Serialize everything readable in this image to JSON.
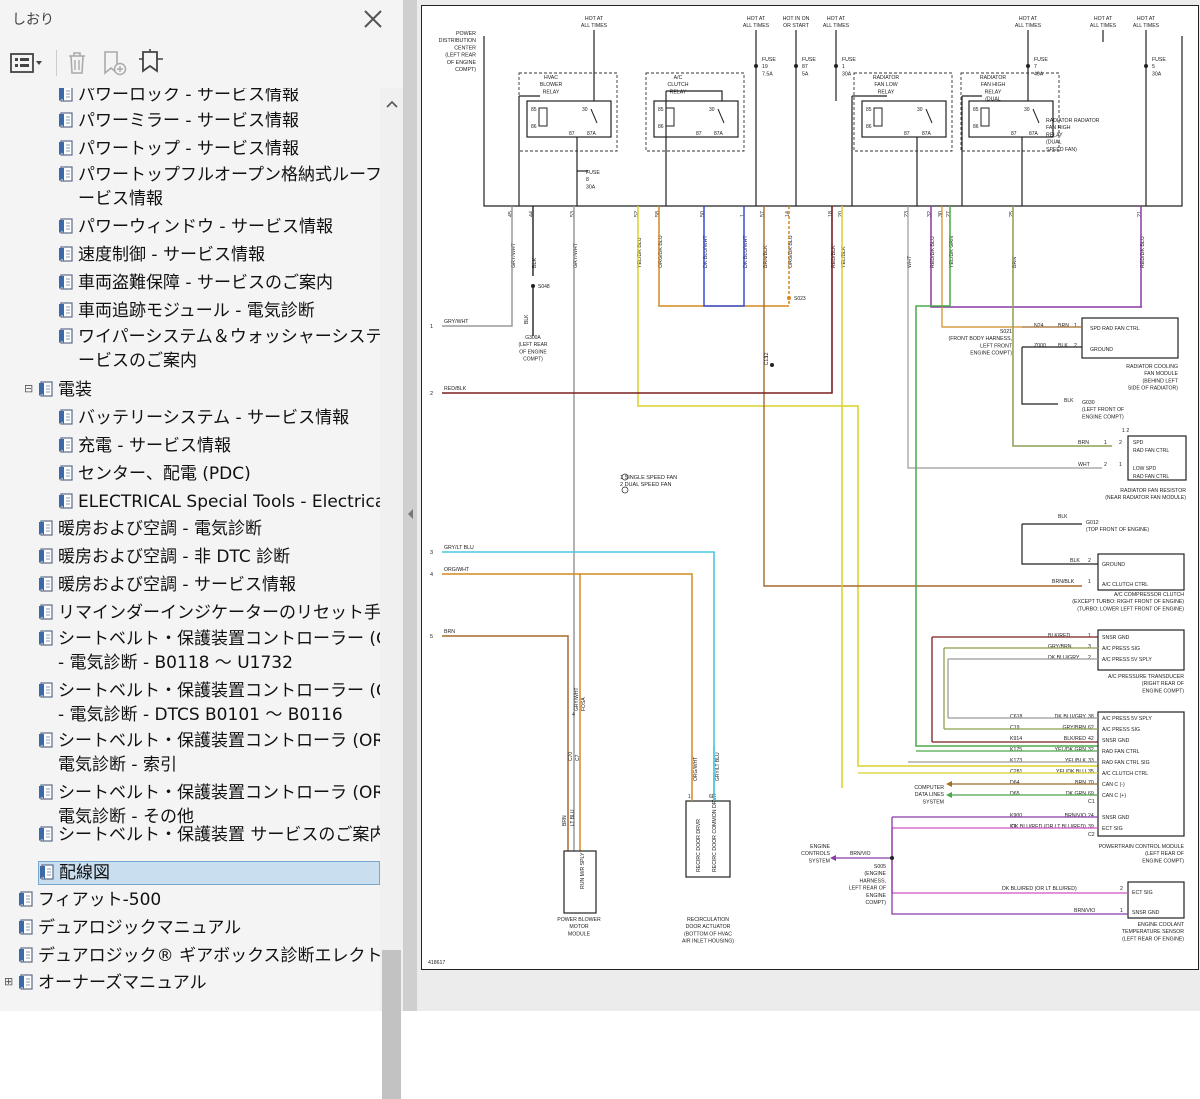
{
  "bookmarks_panel": {
    "title": "しおり",
    "toolbar": {
      "options": "options-menu-icon",
      "delete": "trash-icon",
      "add_bookmark": "bookmark-add-icon",
      "find_current": "bookmark-find-icon"
    },
    "items": [
      {
        "label": "パワーロック - サービス情報",
        "level": 2
      },
      {
        "label": "パワーミラー - サービス情報",
        "level": 2
      },
      {
        "label": "パワートップ - サービス情報",
        "level": 2
      },
      {
        "label": "パワートップフルオープン格納式ルーフ - サ",
        "label2": "ービス情報",
        "level": 2
      },
      {
        "label": "パワーウィンドウ - サービス情報",
        "level": 2
      },
      {
        "label": "速度制御 - サービス情報",
        "level": 2
      },
      {
        "label": "車両盗難保障 - サービスのご案内",
        "level": 2
      },
      {
        "label": "車両追跡モジュール - 電気診断",
        "level": 2
      },
      {
        "label": "ワイパーシステム＆ウォッシャーシステム - サ",
        "label2": "ービスのご案内",
        "level": 2
      },
      {
        "label": "電装",
        "level": 1,
        "expanded": true
      },
      {
        "label": "バッテリーシステム - サービス情報",
        "level": 2
      },
      {
        "label": "充電 - サービス情報",
        "level": 2
      },
      {
        "label": "センター、配電 (PDC)",
        "level": 2
      },
      {
        "label": "ELECTRICAL Special Tools - Electrical",
        "level": 2
      },
      {
        "label": "暖房および空調 - 電気診断",
        "level": 1
      },
      {
        "label": "暖房および空調 - 非 DTC 診断",
        "level": 1
      },
      {
        "label": "暖房および空調 - サービス情報",
        "level": 1
      },
      {
        "label": "リマインダーインジケーターのリセット手順",
        "level": 1
      },
      {
        "label": "シートベルト・保護装置コントローラー (ORC)",
        "label2": "- 電気診断 - B0118 ～ U1732",
        "level": 1
      },
      {
        "label": "シートベルト・保護装置コントローラー (ORC)",
        "label2": "- 電気診断 - DTCS B0101 ～ B0116",
        "level": 1
      },
      {
        "label": "シートベルト・保護装置コントローラ (ORC) -",
        "label2": "電気診断 - 索引",
        "level": 1
      },
      {
        "label": "シートベルト・保護装置コントローラ (ORC) -",
        "label2": "電気診断 - その他",
        "level": 1
      },
      {
        "label": "シートベルト・保護装置 サービスのご案内",
        "level": 1
      },
      {
        "label": "配線図",
        "level": 1,
        "selected": true
      },
      {
        "label": "フィアット-500",
        "level": 0
      },
      {
        "label": "デュアロジックマニュアル",
        "level": 0
      },
      {
        "label": "デュアロジック® ギアボックス診断エレクトロニクス",
        "level": 0
      },
      {
        "label": "オーナーズマニュアル",
        "level": 0,
        "collapsed": true
      }
    ]
  },
  "diagram": {
    "top_labels": {
      "hot_all_1": [
        "HOT AT",
        "ALL TIMES"
      ],
      "hot_all_2": [
        "HOT AT",
        "ALL TIMES"
      ],
      "hot_run": [
        "HOT IN ON",
        "OR START"
      ],
      "hot_all_3": [
        "HOT AT",
        "ALL TIMES"
      ],
      "hot_all_4": [
        "HOT AT",
        "ALL TIMES"
      ],
      "hot_all_5": [
        "HOT AT",
        "ALL TIMES"
      ],
      "hot_all_6": [
        "HOT AT",
        "ALL TIMES"
      ]
    },
    "pdc": [
      "POWER",
      "DISTRIBUTION",
      "CENTER",
      "(LEFT REAR",
      "OF ENGINE",
      "COMPT)"
    ],
    "fuses": [
      [
        "FUSE",
        "19",
        "7.5A"
      ],
      [
        "FUSE",
        "87",
        "5A"
      ],
      [
        "FUSE",
        "1",
        "30A"
      ],
      [
        "FUSE",
        "7",
        "40A"
      ],
      [
        "FUSE",
        "5",
        "30A"
      ],
      [
        "FUSE",
        "8",
        "30A"
      ]
    ],
    "relays": {
      "blower": [
        "HVAC",
        "BLOWER",
        "RELAY"
      ],
      "clutch": [
        "A/C",
        "CLUTCH",
        "RELAY"
      ],
      "fan_low": [
        "RADIATOR",
        "FAN LOW",
        "RELAY"
      ],
      "fan_high": [
        "RADIATOR",
        "FAN HIGH",
        "RELAY",
        "(DUAL",
        "SPEED FAN)"
      ]
    },
    "pins_top": [
      "45",
      "44",
      "53",
      "52",
      "58",
      "50",
      "1",
      "57",
      "14",
      "18",
      "20",
      "23",
      "32",
      "30",
      "27",
      "25",
      "21"
    ],
    "vwires": [
      "GRY/WHT",
      "BLK",
      "GRY/WHT",
      "YEL/DK BLU",
      "ORG/DK BLU",
      "DK BLU/WHT",
      "DK BLU/WHT",
      "BRN/BLK",
      "ORG/DK BLU",
      "RED/BLK",
      "YEL/BLK",
      "WHT",
      "RED/DK BLU",
      "YEL/DK GRN",
      "BRN",
      "RED/DK BLU"
    ],
    "left_numbers": [
      "1",
      "2",
      "3",
      "4",
      "5"
    ],
    "left_wires": [
      "GRY/WHT",
      "RED/BLK",
      "GRY/LT BLU",
      "ORG/WHT",
      "BRN"
    ],
    "splices": {
      "s048": "S048",
      "g300": [
        "G300A",
        "(LEFT REAR",
        "OF ENGINE",
        "COMPT)"
      ],
      "s023": "S023",
      "c13": [
        "12",
        "C13"
      ]
    },
    "legend": [
      "1 SINGLE SPEED FAN",
      "2 DUAL SPEED FAN"
    ],
    "rad_fan_module": {
      "pins": [
        [
          "N24",
          "BRN",
          "1",
          "SPD RAD FAN CTRL"
        ],
        [
          "Z000",
          "BLK",
          "2",
          "GROUND"
        ]
      ],
      "splice": [
        "S021",
        "(FRONT BODY HARNESS,",
        "LEFT FRONT",
        "ENGINE COMPT)"
      ],
      "name": [
        "RADIATOR COOLING",
        "FAN MODULE",
        "(BEHIND LEFT",
        "SIDE OF RADIATOR)"
      ],
      "ground": [
        "G030",
        "(LEFT FRONT OF",
        "ENGINE COMPT)",
        "BLK"
      ]
    },
    "rad_fan_resistor": {
      "pins": [
        [
          "BRN",
          "1",
          "2",
          "SPD",
          "RAD FAN CTRL"
        ],
        [
          "WHT",
          "2",
          "1",
          "LOW SPD",
          "RAD FAN CTRL"
        ]
      ],
      "name": [
        "RADIATOR FAN RESISTOR",
        "(NEAR RADIATOR FAN MODULE)"
      ]
    },
    "compressor": {
      "ground": [
        "BLK",
        "G012",
        "(TOP FRONT OF ENGINE)"
      ],
      "pins": [
        [
          "BLK",
          "2",
          "GROUND"
        ],
        [
          "BRN/BLK",
          "1",
          "A/C CLUTCH CTRL"
        ]
      ],
      "name": [
        "A/C COMPRESSOR CLUTCH",
        "(EXCEPT TURBO: RIGHT FRONT OF ENGINE)",
        "(TURBO: LOWER LEFT FRONT OF ENGINE)"
      ]
    },
    "transducer": {
      "pins": [
        [
          "BLK/RED",
          "1",
          "SNSR GND"
        ],
        [
          "GRY/BRN",
          "3",
          "A/C PRESS SIG"
        ],
        [
          "DK BLU/GRY",
          "2",
          "A/C PRESS 5V SPLY"
        ]
      ],
      "name": [
        "A/C PRESSURE TRANSDUCER",
        "(RIGHT REAR OF",
        "ENGINE COMPT)"
      ]
    },
    "pcm": {
      "rows": [
        [
          "C618",
          "DK BLU/GRY",
          "38",
          "A/C PRESS 5V SPLY"
        ],
        [
          "C19",
          "GRY/BRN",
          "62",
          "A/C PRESS SIG"
        ],
        [
          "K914",
          "BLK/RED",
          "42",
          "SNSR GND"
        ],
        [
          "K175",
          "YEL/DK GRN",
          "32",
          "RAD FAN CTRL"
        ],
        [
          "K173",
          "YEL/BLK",
          "33",
          "RAD FAN CTRL SIG"
        ],
        [
          "C281",
          "YEL/DK BLU",
          "35",
          "A/C CLUTCH CTRL"
        ],
        [
          "D64",
          "BRN",
          "70",
          "CAN C (-)"
        ],
        [
          "D65",
          "DK GRN",
          "69",
          "CAN C (+)"
        ],
        [
          "",
          "",
          "C1",
          ""
        ],
        [
          "K900",
          "BRN/VIO",
          "24",
          "SNSR GND"
        ],
        [
          "K2",
          "DK BLU/RED (OR LT BLU/RED)",
          "39",
          "ECT SIG"
        ],
        [
          "",
          "",
          "C2",
          ""
        ]
      ],
      "name": [
        "POWERTRAIN CONTROL MODULE",
        "(LEFT REAR OF",
        "ENGINE COMPT)"
      ],
      "comp_data": [
        "COMPUTER",
        "DATA LINES",
        "SYSTEM"
      ]
    },
    "ect": {
      "rows": [
        [
          "DK BLU/RED (OR LT BLU/RED)",
          "2",
          "ECT SIG"
        ],
        [
          "BRN/VIO",
          "1",
          "SNSR GND"
        ]
      ],
      "name": [
        "ENGINE COOLANT",
        "TEMPERATURE SENSOR",
        "(LEFT REAR OF ENGINE)"
      ],
      "ecs": [
        "ENGINE",
        "CONTROLS",
        "SYSTEM"
      ],
      "splice": [
        "S005",
        "(ENGINE",
        "HARNESS,",
        "LEFT REAR OF",
        "ENGINE",
        "COMPT)"
      ],
      "wire": "BRN/VIO"
    },
    "blower_module": {
      "box": "RUN M/R SPLY",
      "wires": [
        "GRY/WHT",
        "FOSA",
        "C70",
        "C7",
        "BRN",
        "LT BLU"
      ],
      "conn": "4",
      "name": [
        "POWER BLOWER",
        "MOTOR",
        "MODULE"
      ]
    },
    "recirc": {
      "box1": "RECIRC DOOR DRVR",
      "box2": "RECIRC DOOR COMMON DRVR",
      "wires": [
        "ORG/WHT",
        "GRY/LT BLU"
      ],
      "pins": [
        "1",
        "6"
      ],
      "name": [
        "RECIRCULATION",
        "DOOR ACTUATOR",
        "(BOTTOM OF HVAC",
        "AIR INLET HOUSING)"
      ]
    },
    "doc_id": "418617",
    "colors": {
      "red_blk": "#7a1f1f",
      "yellow": "#d8d02a",
      "orange": "#d48a20",
      "blue": "#3b4fd0",
      "purple": "#8a3aa8",
      "cyan": "#48c8e0",
      "brown": "#a56a2c",
      "green": "#4aa84a",
      "olive": "#8aa050",
      "magenta": "#d050c0",
      "gray": "#9a9a9a"
    }
  }
}
